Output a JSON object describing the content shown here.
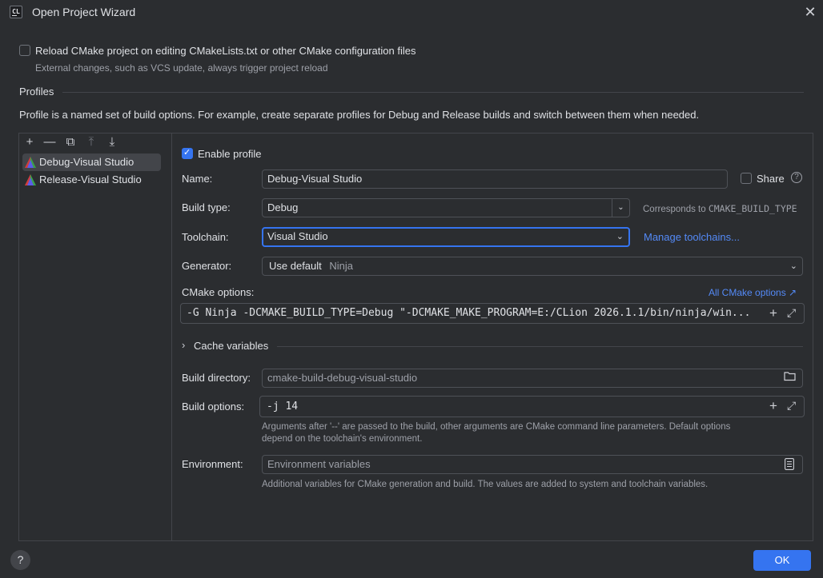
{
  "window": {
    "title": "Open Project Wizard"
  },
  "reload": {
    "label": "Reload CMake project on editing CMakeLists.txt or other CMake configuration files",
    "hint": "External changes, such as VCS update, always trigger project reload",
    "checked": false
  },
  "profiles": {
    "section_title": "Profiles",
    "description": "Profile is a named set of build options. For example, create separate profiles for Debug and Release builds and switch between them when needed.",
    "toolbar": {
      "add": "+",
      "remove": "—",
      "copy": "⧉",
      "move_up": "⤒",
      "move_down": "⤓"
    },
    "items": [
      {
        "label": "Debug-Visual Studio",
        "selected": true
      },
      {
        "label": "Release-Visual Studio",
        "selected": false
      }
    ]
  },
  "form": {
    "enable_profile_label": "Enable profile",
    "enable_profile_checked": true,
    "name_label": "Name:",
    "name_value": "Debug-Visual Studio",
    "share_label": "Share",
    "build_type_label": "Build type:",
    "build_type_value": "Debug",
    "build_type_hint_prefix": "Corresponds to ",
    "build_type_hint_code": "CMAKE_BUILD_TYPE",
    "toolchain_label": "Toolchain:",
    "toolchain_value": "Visual Studio",
    "manage_toolchains_link": "Manage toolchains...",
    "generator_label": "Generator:",
    "generator_value": "Use default",
    "generator_default_hint": "Ninja",
    "cmake_options_label": "CMake options:",
    "all_cmake_options_link": "All CMake options ↗",
    "cmake_options_value": "-G Ninja -DCMAKE_BUILD_TYPE=Debug \"-DCMAKE_MAKE_PROGRAM=E:/CLion 2026.1.1/bin/ninja/win...",
    "cache_variables_label": "Cache variables",
    "build_directory_label": "Build directory:",
    "build_directory_value": "cmake-build-debug-visual-studio",
    "build_options_label": "Build options:",
    "build_options_value": "-j 14",
    "build_options_note_line1": "Arguments after '--' are passed to the build, other arguments are CMake command line parameters. Default options",
    "build_options_note_line2": "depend on the toolchain's environment.",
    "environment_label": "Environment:",
    "environment_placeholder": "Environment variables",
    "environment_note": "Additional variables for CMake generation and build. The values are added to system and toolchain variables."
  },
  "footer": {
    "ok_label": "OK",
    "help_label": "?"
  },
  "colors": {
    "background": "#2b2d30",
    "accent": "#3574f0",
    "link": "#548af7",
    "border": "#4e5157"
  }
}
